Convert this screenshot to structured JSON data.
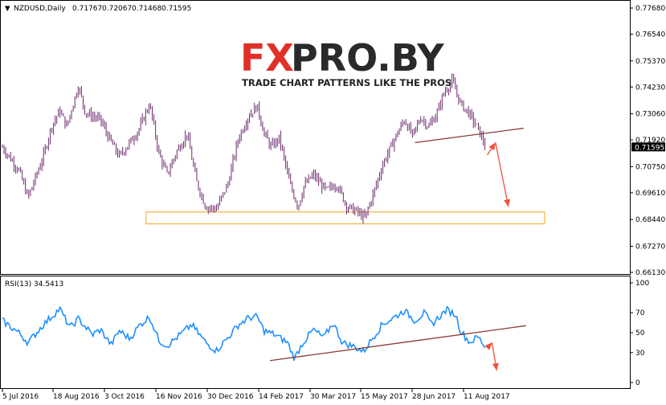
{
  "main_chart": {
    "symbol_timeframe": "NZDUSD,Daily",
    "ohlc": [
      "0.71767",
      "0.72067",
      "0.71468",
      "0.71595"
    ],
    "current_price": "0.71595",
    "y_ticks": [
      "0.77680",
      "0.76540",
      "0.75370",
      "0.74230",
      "0.73060",
      "0.71920",
      "0.70750",
      "0.69610",
      "0.68440",
      "0.67270",
      "0.66130"
    ]
  },
  "watermark": {
    "brand_fx": "FX",
    "brand_rest": "PRO.BY",
    "tagline": "TRADE CHART PATTERNS LIKE THE PROS"
  },
  "rsi_panel": {
    "label": "RSI(13) 34.5413",
    "y_ticks": [
      "100",
      "70",
      "50",
      "30",
      "0"
    ]
  },
  "x_axis": {
    "labels": [
      "5 Jul 2016",
      "18 Aug 2016",
      "3 Oct 2016",
      "16 Nov 2016",
      "30 Dec 2016",
      "14 Feb 2017",
      "30 Mar 2017",
      "15 May 2017",
      "28 Jun 2017",
      "11 Aug 2017"
    ]
  },
  "colors": {
    "candle": "#6b2a6b",
    "rsi_line": "#1e90ff",
    "trendline": "#8b3a3a",
    "arrow": "#f0503a",
    "support_zone": "#f5a623",
    "logo_red": "#e03028",
    "logo_dark": "#2a2a2a",
    "price_tag_bg": "#000000"
  },
  "chart_data": {
    "type": "candlestick",
    "price_range": [
      0.6613,
      0.7768
    ],
    "rsi_range": [
      0,
      100
    ],
    "price_anchors": [
      {
        "date": "2016-07-05",
        "close": 0.716
      },
      {
        "date": "2016-07-19",
        "close": 0.706
      },
      {
        "date": "2016-07-27",
        "close": 0.694
      },
      {
        "date": "2016-08-09",
        "close": 0.712
      },
      {
        "date": "2016-08-16",
        "close": 0.725
      },
      {
        "date": "2016-08-23",
        "close": 0.732
      },
      {
        "date": "2016-08-29",
        "close": 0.725
      },
      {
        "date": "2016-09-08",
        "close": 0.743
      },
      {
        "date": "2016-09-14",
        "close": 0.731
      },
      {
        "date": "2016-09-27",
        "close": 0.728
      },
      {
        "date": "2016-10-04",
        "close": 0.72
      },
      {
        "date": "2016-10-13",
        "close": 0.712
      },
      {
        "date": "2016-10-22",
        "close": 0.718
      },
      {
        "date": "2016-10-30",
        "close": 0.724
      },
      {
        "date": "2016-11-08",
        "close": 0.735
      },
      {
        "date": "2016-11-16",
        "close": 0.713
      },
      {
        "date": "2016-11-23",
        "close": 0.704
      },
      {
        "date": "2016-12-01",
        "close": 0.714
      },
      {
        "date": "2016-12-10",
        "close": 0.722
      },
      {
        "date": "2016-12-18",
        "close": 0.701
      },
      {
        "date": "2016-12-26",
        "close": 0.69
      },
      {
        "date": "2017-01-04",
        "close": 0.689
      },
      {
        "date": "2017-01-14",
        "close": 0.7
      },
      {
        "date": "2017-01-23",
        "close": 0.72
      },
      {
        "date": "2017-02-01",
        "close": 0.73
      },
      {
        "date": "2017-02-08",
        "close": 0.734
      },
      {
        "date": "2017-02-14",
        "close": 0.722
      },
      {
        "date": "2017-02-20",
        "close": 0.716
      },
      {
        "date": "2017-02-27",
        "close": 0.72
      },
      {
        "date": "2017-03-08",
        "close": 0.7
      },
      {
        "date": "2017-03-15",
        "close": 0.69
      },
      {
        "date": "2017-03-20",
        "close": 0.699
      },
      {
        "date": "2017-03-28",
        "close": 0.704
      },
      {
        "date": "2017-04-08",
        "close": 0.697
      },
      {
        "date": "2017-04-17",
        "close": 0.7
      },
      {
        "date": "2017-04-26",
        "close": 0.69
      },
      {
        "date": "2017-05-04",
        "close": 0.688
      },
      {
        "date": "2017-05-11",
        "close": 0.685
      },
      {
        "date": "2017-05-18",
        "close": 0.695
      },
      {
        "date": "2017-05-26",
        "close": 0.708
      },
      {
        "date": "2017-06-06",
        "close": 0.72
      },
      {
        "date": "2017-06-14",
        "close": 0.728
      },
      {
        "date": "2017-06-21",
        "close": 0.721
      },
      {
        "date": "2017-06-28",
        "close": 0.729
      },
      {
        "date": "2017-07-05",
        "close": 0.725
      },
      {
        "date": "2017-07-12",
        "close": 0.731
      },
      {
        "date": "2017-07-18",
        "close": 0.74
      },
      {
        "date": "2017-07-25",
        "close": 0.745
      },
      {
        "date": "2017-08-01",
        "close": 0.735
      },
      {
        "date": "2017-08-08",
        "close": 0.731
      },
      {
        "date": "2017-08-16",
        "close": 0.724
      },
      {
        "date": "2017-08-23",
        "close": 0.716
      }
    ],
    "rsi_anchors": [
      {
        "date": "2016-07-05",
        "rsi": 62
      },
      {
        "date": "2016-07-19",
        "rsi": 50
      },
      {
        "date": "2016-07-27",
        "rsi": 40
      },
      {
        "date": "2016-08-09",
        "rsi": 58
      },
      {
        "date": "2016-08-23",
        "rsi": 74
      },
      {
        "date": "2016-09-01",
        "rsi": 55
      },
      {
        "date": "2016-09-08",
        "rsi": 64
      },
      {
        "date": "2016-09-20",
        "rsi": 48
      },
      {
        "date": "2016-09-27",
        "rsi": 53
      },
      {
        "date": "2016-10-06",
        "rsi": 38
      },
      {
        "date": "2016-10-13",
        "rsi": 52
      },
      {
        "date": "2016-10-22",
        "rsi": 44
      },
      {
        "date": "2016-10-30",
        "rsi": 57
      },
      {
        "date": "2016-11-08",
        "rsi": 66
      },
      {
        "date": "2016-11-16",
        "rsi": 42
      },
      {
        "date": "2016-11-23",
        "rsi": 37
      },
      {
        "date": "2016-12-04",
        "rsi": 48
      },
      {
        "date": "2016-12-14",
        "rsi": 58
      },
      {
        "date": "2016-12-26",
        "rsi": 40
      },
      {
        "date": "2017-01-04",
        "rsi": 32
      },
      {
        "date": "2017-01-14",
        "rsi": 45
      },
      {
        "date": "2017-01-23",
        "rsi": 58
      },
      {
        "date": "2017-02-01",
        "rsi": 65
      },
      {
        "date": "2017-02-08",
        "rsi": 66
      },
      {
        "date": "2017-02-14",
        "rsi": 52
      },
      {
        "date": "2017-02-23",
        "rsi": 48
      },
      {
        "date": "2017-03-06",
        "rsi": 40
      },
      {
        "date": "2017-03-12",
        "rsi": 24
      },
      {
        "date": "2017-03-18",
        "rsi": 38
      },
      {
        "date": "2017-03-28",
        "rsi": 53
      },
      {
        "date": "2017-04-06",
        "rsi": 45
      },
      {
        "date": "2017-04-14",
        "rsi": 60
      },
      {
        "date": "2017-04-22",
        "rsi": 40
      },
      {
        "date": "2017-05-02",
        "rsi": 36
      },
      {
        "date": "2017-05-10",
        "rsi": 31
      },
      {
        "date": "2017-05-18",
        "rsi": 45
      },
      {
        "date": "2017-05-26",
        "rsi": 58
      },
      {
        "date": "2017-06-06",
        "rsi": 66
      },
      {
        "date": "2017-06-14",
        "rsi": 72
      },
      {
        "date": "2017-06-23",
        "rsi": 62
      },
      {
        "date": "2017-07-01",
        "rsi": 70
      },
      {
        "date": "2017-07-07",
        "rsi": 58
      },
      {
        "date": "2017-07-14",
        "rsi": 66
      },
      {
        "date": "2017-07-20",
        "rsi": 73
      },
      {
        "date": "2017-07-28",
        "rsi": 68
      },
      {
        "date": "2017-08-01",
        "rsi": 52
      },
      {
        "date": "2017-08-09",
        "rsi": 40
      },
      {
        "date": "2017-08-16",
        "rsi": 46
      },
      {
        "date": "2017-08-23",
        "rsi": 34.5
      }
    ],
    "annotations": {
      "price_trendline": [
        {
          "date": "2017-06-23",
          "price": 0.718
        },
        {
          "date": "2017-09-24",
          "price": 0.7243
        }
      ],
      "support_zone": {
        "from": "2016-11-05",
        "to": "2017-10-12",
        "low": 0.6825,
        "high": 0.6877
      },
      "price_forecast_path": [
        {
          "date": "2017-08-24",
          "price": 0.7126
        },
        {
          "date": "2017-08-31",
          "price": 0.718
        },
        {
          "date": "2017-09-11",
          "price": 0.69
        }
      ],
      "rsi_trendline": [
        {
          "date": "2017-02-19",
          "rsi": 22
        },
        {
          "date": "2017-09-26",
          "rsi": 57
        }
      ],
      "rsi_forecast_path": [
        {
          "date": "2017-08-24",
          "rsi": 35
        },
        {
          "date": "2017-08-28",
          "rsi": 40
        },
        {
          "date": "2017-09-01",
          "rsi": 12
        }
      ]
    }
  }
}
